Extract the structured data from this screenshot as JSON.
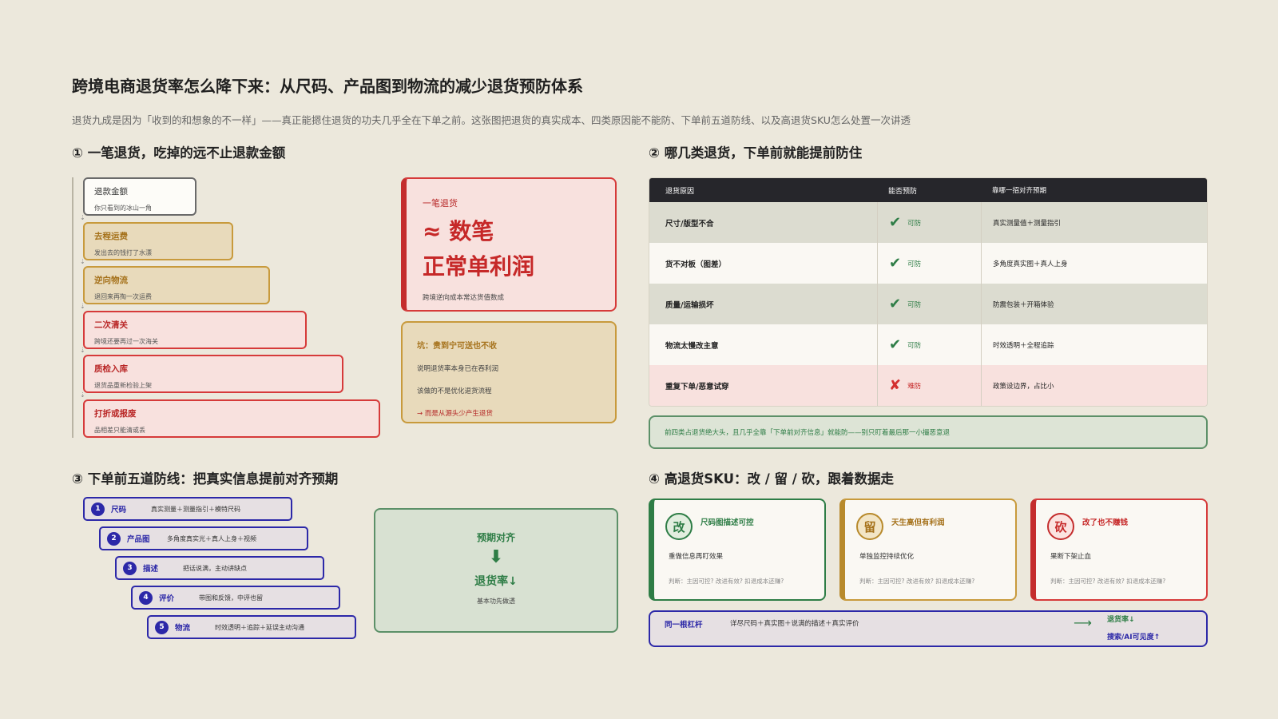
{
  "title": "跨境电商退货率怎么降下来：从尺码、产品图到物流的减少退货预防体系",
  "subtitle": "退货九成是因为「收到的和想象的不一样」——真正能摁住退货的功夫几乎全在下单之前。这张图把退货的真实成本、四类原因能不能防、下单前五道防线、以及高退货SKU怎么处置一次讲透",
  "section1": {
    "title": "① 一笔退货，吃掉的远不止退款金额",
    "stairs": [
      {
        "title": "退款金额",
        "desc": "你只看到的冰山一角"
      },
      {
        "title": "去程运费",
        "desc": "发出去的钱打了水漂"
      },
      {
        "title": "逆向物流",
        "desc": "退回来再掏一次运费"
      },
      {
        "title": "二次清关",
        "desc": "跨境还要再过一次海关"
      },
      {
        "title": "质检入库",
        "desc": "退货品重新检验上架"
      },
      {
        "title": "打折或报废",
        "desc": "品相差只能清或丢"
      }
    ],
    "cost_card": {
      "label": "一笔退货",
      "big1": "≈ 数笔",
      "big2": "正常单利润",
      "note": "跨境逆向成本常达货值数成"
    },
    "pit_card": {
      "title": "坑：贵到宁可送也不收",
      "line1": "说明退货率本身已在吞利润",
      "line2": "该做的不是优化退货流程",
      "line3": "→ 而是从源头少产生退货"
    }
  },
  "section2": {
    "title": "② 哪几类退货，下单前就能提前防住",
    "headers": [
      "退货原因",
      "能否预防",
      "靠哪一招对齐预期"
    ],
    "rows": [
      {
        "reason": "尺寸/版型不合",
        "status": "可防",
        "fix": "真实测量值＋测量指引"
      },
      {
        "reason": "货不对板（图差）",
        "status": "可防",
        "fix": "多角度真实图＋真人上身"
      },
      {
        "reason": "质量/运输损坏",
        "status": "可防",
        "fix": "防震包装＋开箱体验"
      },
      {
        "reason": "物流太慢改主意",
        "status": "可防",
        "fix": "时效透明＋全程追踪"
      },
      {
        "reason": "重复下单/恶意试穿",
        "status": "难防",
        "fix": "政策设边界，占比小"
      }
    ],
    "note": "前四类占退货绝大头，且几乎全靠「下单前对齐信息」就能防——别只盯着最后那一小撮恶意退"
  },
  "section3": {
    "title": "③ 下单前五道防线：把真实信息提前对齐预期",
    "steps": [
      {
        "num": "1",
        "name": "尺码",
        "desc": "真实测量＋测量指引＋模特尺码"
      },
      {
        "num": "2",
        "name": "产品图",
        "desc": "多角度真实光＋真人上身＋视频"
      },
      {
        "num": "3",
        "name": "描述",
        "desc": "把话说满，主动讲缺点"
      },
      {
        "num": "4",
        "name": "评价",
        "desc": "带图和反馈，中评也留"
      },
      {
        "num": "5",
        "name": "物流",
        "desc": "时效透明＋追踪＋延误主动沟通"
      }
    ],
    "expect": {
      "top": "预期对齐",
      "arrow": "⬇",
      "result": "退货率↓",
      "note": "基本功先做透"
    }
  },
  "section4": {
    "title": "④ 高退货SKU：改 / 留 / 砍，跟着数据走",
    "cards": [
      {
        "badge": "改",
        "head": "尺码图描述可控",
        "action": "重做信息再盯效果",
        "question": "判断：主因可控? 改进有效? 扣退成本还赚?"
      },
      {
        "badge": "留",
        "head": "天生高但有利润",
        "action": "单独监控持续优化",
        "question": "判断：主因可控? 改进有效? 扣退成本还赚?"
      },
      {
        "badge": "砍",
        "head": "改了也不赚钱",
        "action": "果断下架止血",
        "question": "判断：主因可控? 改进有效? 扣退成本还赚?"
      }
    ],
    "lever": {
      "label": "同一根杠杆",
      "text": "详尽尺码＋真实图＋说满的描述＋真实评价",
      "arrow": "⟶",
      "result1": "退货率↓",
      "result2": "搜索/AI可见度↑"
    }
  },
  "colors": {
    "bg": "#ece8dc",
    "red": "#c62828",
    "green": "#2e7d46",
    "gold": "#a5711a",
    "indigo": "#2c28a8"
  }
}
